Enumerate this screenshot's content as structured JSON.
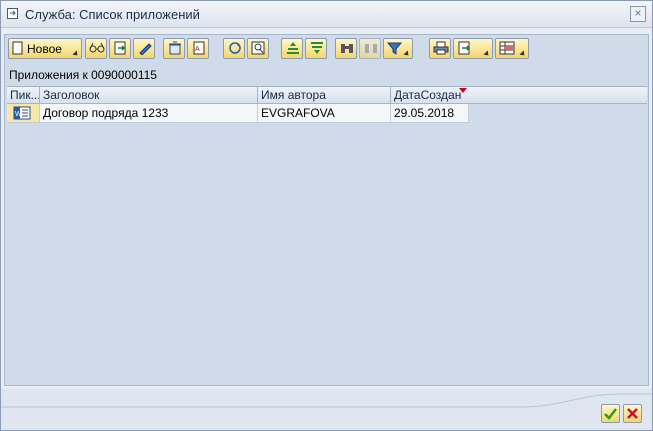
{
  "window": {
    "title": "Служба: Список приложений",
    "close_glyph": "×"
  },
  "toolbar": {
    "new_label": "Новое",
    "buttons": [
      "new-button",
      "glasses-icon",
      "import-icon",
      "edit-icon",
      "delete-icon",
      "pdf-icon",
      "refresh-icon",
      "zoom-icon",
      "sort-asc-icon",
      "filter-icon",
      "find-icon",
      "find-next-icon",
      "filter-menu-icon",
      "print-icon",
      "export-icon",
      "layout-icon"
    ]
  },
  "heading": "Приложения к 0090000115",
  "table": {
    "columns": [
      "Пик...",
      "Заголовок",
      "Имя автора",
      "ДатаСоздан"
    ],
    "rows": [
      {
        "icon": "word-doc-icon",
        "title": "Договор подряда 1233",
        "author": "EVGRAFOVA",
        "date": "29.05.2018"
      }
    ]
  },
  "colors": {
    "accent": "#f2d66c",
    "sort_marker": "#d0021b",
    "ok": "#2e9a1f",
    "cancel": "#c8102e"
  }
}
